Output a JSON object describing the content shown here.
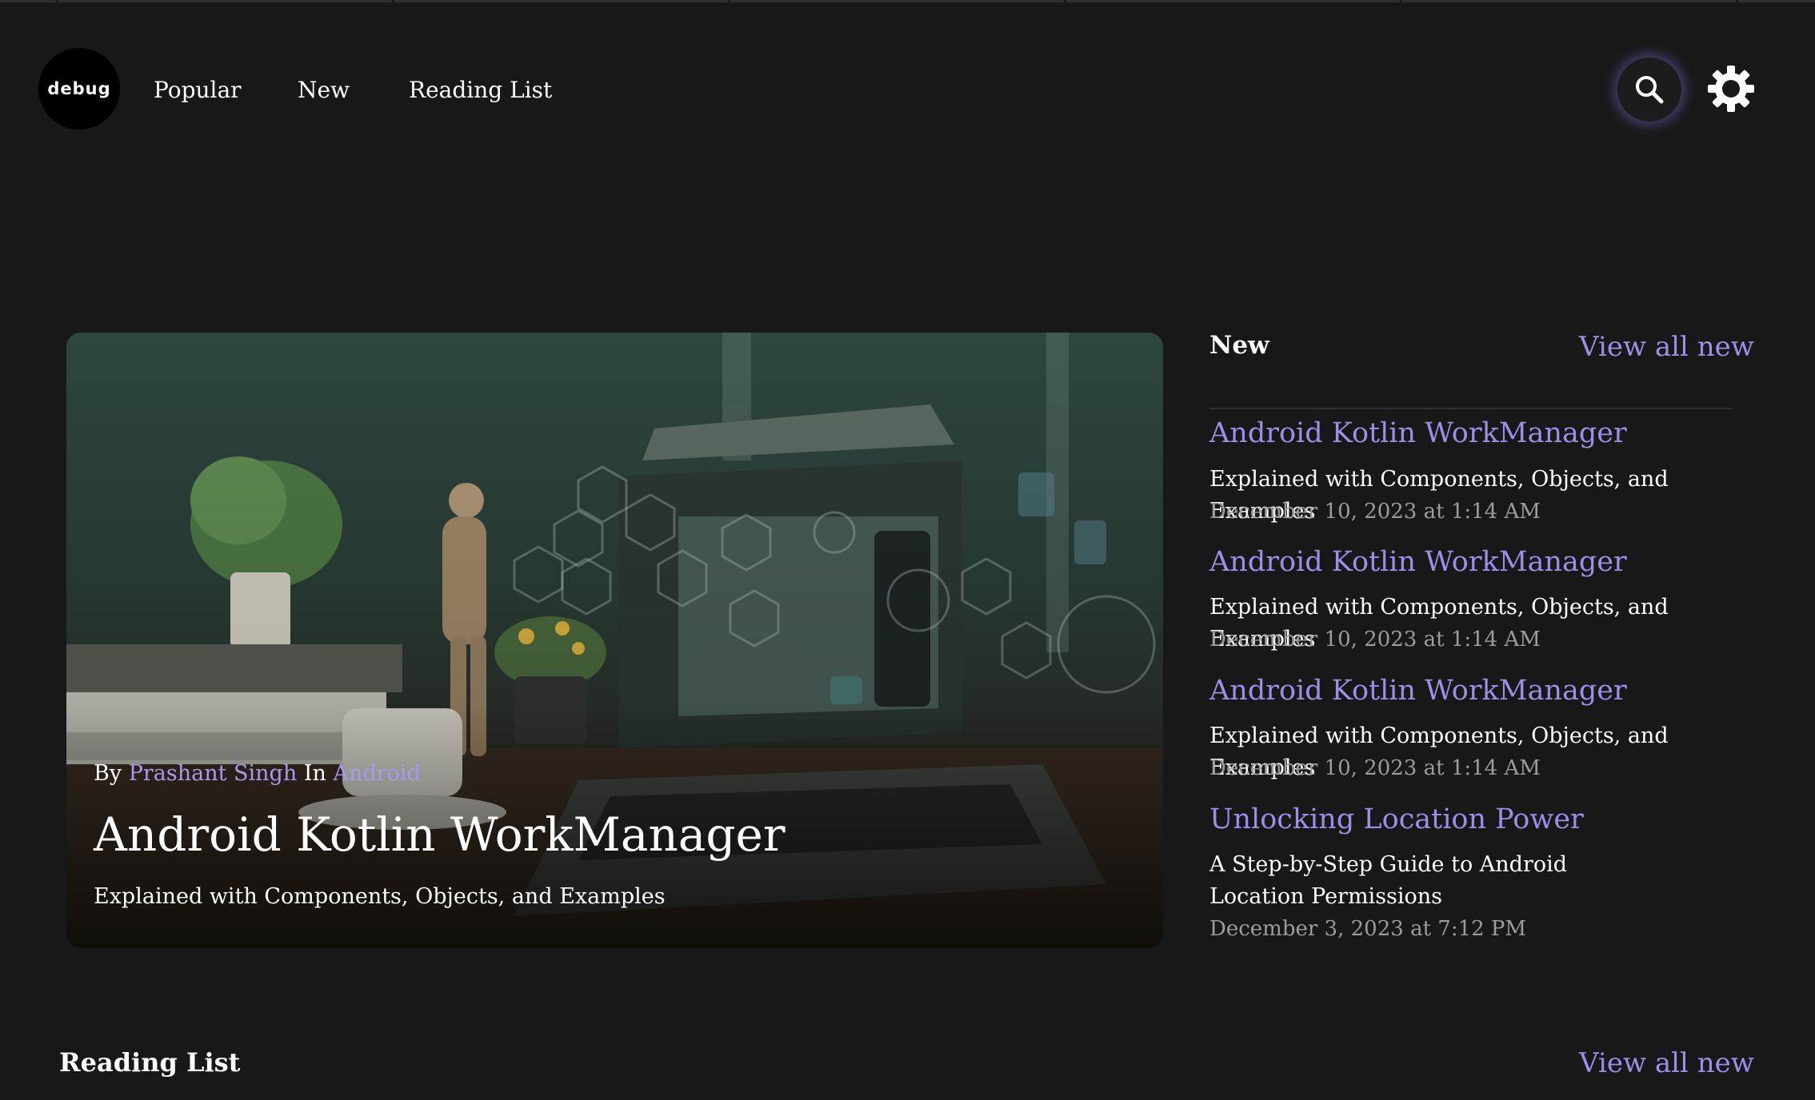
{
  "logo": {
    "text": "debug"
  },
  "nav": {
    "items": [
      "Popular",
      "New",
      "Reading List"
    ]
  },
  "header": {
    "search_icon": "search-icon",
    "theme_icon": "gear-icon"
  },
  "colors": {
    "background": "#181818",
    "accent": "#9d8ee8",
    "text": "#ffffff",
    "muted": "#9c9c9c"
  },
  "hero": {
    "by_label": "By",
    "author": "Prashant Singh",
    "in_label": "In",
    "category": "Android",
    "title": "Android Kotlin WorkManager",
    "subtitle": "Explained with Components, Objects, and Examples"
  },
  "sidebar": {
    "heading": "New",
    "view_all": "View all new",
    "items": [
      {
        "title": "Android Kotlin WorkManager",
        "subtitle": "Explained with Components, Objects, and Examples",
        "date": "December 10, 2023 at 1:14 AM"
      },
      {
        "title": "Android Kotlin WorkManager",
        "subtitle": "Explained with Components, Objects, and Examples",
        "date": "December 10, 2023 at 1:14 AM"
      },
      {
        "title": "Android Kotlin WorkManager",
        "subtitle": "Explained with Components, Objects, and Examples",
        "date": "December 10, 2023 at 1:14 AM"
      },
      {
        "title": "Unlocking Location Power",
        "subtitle": "A Step-by-Step Guide to Android Location Permissions",
        "date": "December 3, 2023 at 7:12 PM"
      }
    ]
  },
  "reading_list": {
    "heading": "Reading List",
    "view_all": "View all new"
  }
}
